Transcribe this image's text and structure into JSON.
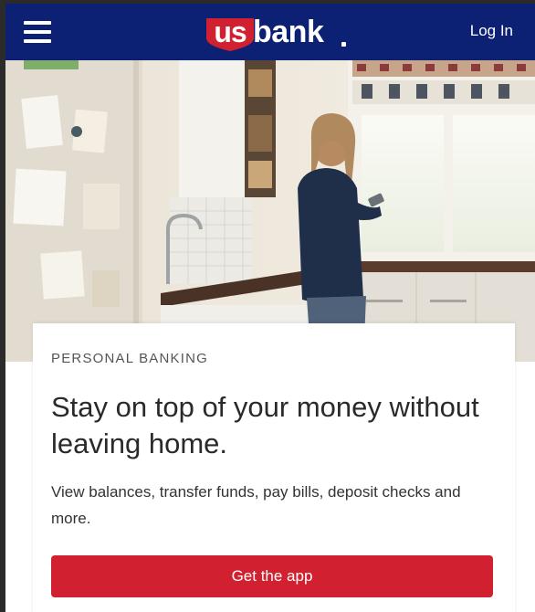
{
  "header": {
    "menu_icon": "hamburger-menu-icon",
    "logo": {
      "us": "us",
      "bank": "bank",
      "alt": "U.S. Bank"
    },
    "login_label": "Log In"
  },
  "hero": {
    "image": "woman-in-kitchen-using-phone"
  },
  "card": {
    "eyebrow": "PERSONAL BANKING",
    "headline": "Stay on top of your money without leaving home.",
    "description": "View balances, transfer funds, pay bills, deposit checks and more.",
    "cta_label": "Get the app"
  },
  "colors": {
    "header_bg": "#0c2074",
    "brand_red": "#d12130",
    "text_dark": "#2a2a2a",
    "eyebrow_gray": "#555555"
  }
}
